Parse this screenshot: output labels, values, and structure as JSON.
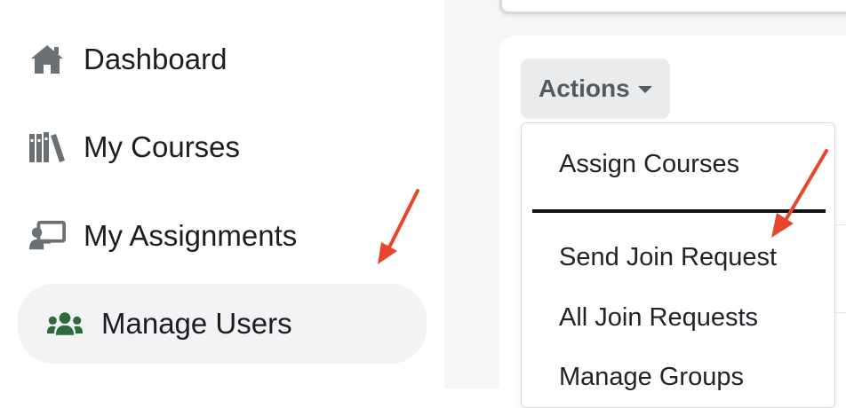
{
  "sidebar": {
    "items": [
      {
        "label": "Dashboard",
        "icon": "home-icon"
      },
      {
        "label": "My Courses",
        "icon": "books-icon"
      },
      {
        "label": "My Assignments",
        "icon": "chalkboard-teacher-icon"
      },
      {
        "label": "Manage Users",
        "icon": "users-icon",
        "active": true
      }
    ]
  },
  "actions": {
    "button_label": "Actions",
    "caret_icon": "caret-down-icon",
    "menu": {
      "items": [
        "Assign Courses",
        "Send Join Request",
        "All Join Requests",
        "Manage Groups"
      ]
    }
  },
  "colors": {
    "active_icon": "#2e6b3a",
    "icon_gray": "#6b7075",
    "annotation_arrow": "#e8452d",
    "active_bg": "#f2f3f5"
  }
}
